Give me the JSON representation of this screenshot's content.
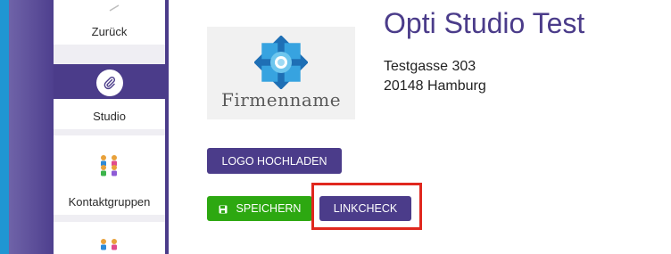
{
  "sidebar": {
    "items": [
      {
        "label": "Zurück",
        "icon": "back-arrow-icon"
      },
      {
        "label": "Studio",
        "icon": "paperclip-icon",
        "active": true
      },
      {
        "label": "Kontaktgruppen",
        "icon": "contact-groups-icon"
      },
      {
        "label": "",
        "icon": "contact-groups-icon"
      }
    ]
  },
  "studio": {
    "title": "Opti Studio Test",
    "street": "Testgasse 303",
    "city": "20148 Hamburg"
  },
  "logo": {
    "name": "Firmenname"
  },
  "buttons": {
    "upload_logo": "LOGO HOCHLADEN",
    "save": "SPEICHERN",
    "linkcheck": "LINKCHECK"
  },
  "colors": {
    "primary": "#4b3c8a",
    "success": "#2da811",
    "highlight": "#e0281e",
    "accent_blue": "#1f96d3"
  }
}
